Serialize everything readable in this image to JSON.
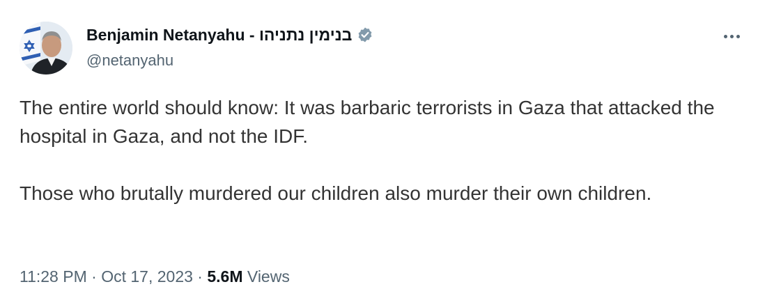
{
  "author": {
    "display_name": "Benjamin Netanyahu - בנימין נתניהו",
    "handle": "@netanyahu",
    "verified_icon": "verified-badge-icon",
    "avatar_icon": "avatar-photo"
  },
  "tweet": {
    "paragraphs": [
      "The entire world should know: It was barbaric terrorists in Gaza that attacked the hospital in Gaza, and not the IDF.",
      "Those who brutally murdered our children also murder their own children."
    ],
    "time": "11:28 PM",
    "separator_1": " · ",
    "date": "Oct 17, 2023",
    "separator_2": " · ",
    "views_count": "5.6M",
    "views_label": " Views"
  },
  "menu_icon": "more-options-icon",
  "colors": {
    "text_primary": "#0f1419",
    "text_secondary": "#536471",
    "body_text": "#333333",
    "verified_badge": "#829aab"
  }
}
